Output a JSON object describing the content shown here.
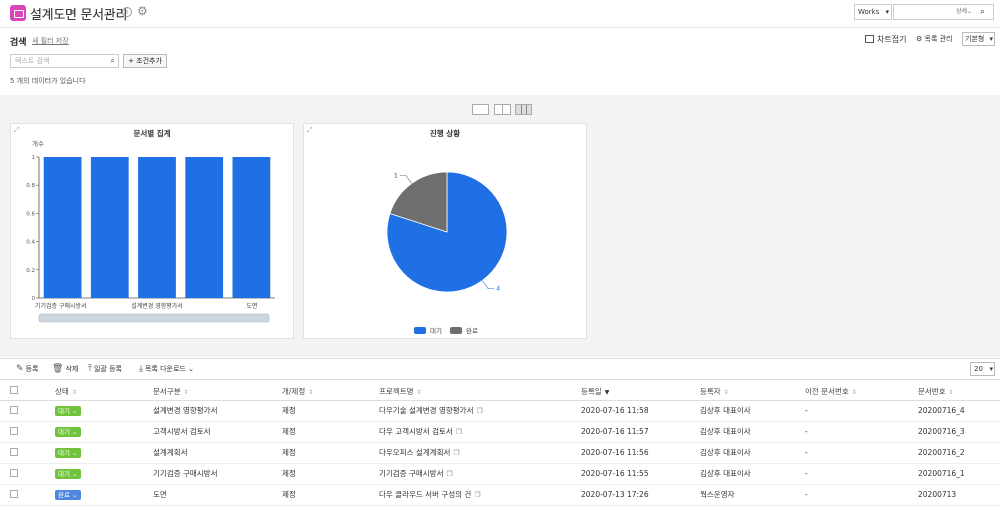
{
  "header": {
    "title": "설계도면 문서관리",
    "works_select": "Works",
    "search_option": "상세"
  },
  "search": {
    "label": "검색",
    "save_filter": "새 필터 저장",
    "placeholder": "텍스트 검색",
    "add_condition": "조건추가",
    "count_text": "5 개의 데이터가 있습니다",
    "chart_toggle": "차트접기",
    "list_mgmt": "목록 관리",
    "view_mode": "기본형"
  },
  "colors": {
    "blue": "#1f6fe5",
    "gray": "#6e6e6e",
    "badge_wait": "#71c33c",
    "badge_done": "#4f86e0",
    "accent_icon": "#d946b8"
  },
  "chart_data": [
    {
      "type": "bar",
      "title": "문서별 집계",
      "ylabel": "개수",
      "categories": [
        "기기검증 구매시방서",
        "고객시방서 검토서",
        "설계변경 영향평가서",
        "설계계획서",
        "도면"
      ],
      "tick_labels": [
        "기기검증 구매시방서",
        "설계변경 영향평가서",
        "도면"
      ],
      "values": [
        1,
        1,
        1,
        1,
        1
      ],
      "ylim": [
        0,
        1
      ],
      "yticks": [
        "0",
        "0.2",
        "0.4",
        "0.6",
        "0.8",
        "1"
      ]
    },
    {
      "type": "pie",
      "title": "진행 상황",
      "labels": [
        "대기",
        "완료"
      ],
      "values": [
        4,
        1
      ],
      "legend": "bottom"
    }
  ],
  "toolbar": {
    "register": "등록",
    "delete": "삭제",
    "bulk_register": "일괄 등록",
    "download_list": "목록 다운로드",
    "page_size": "20"
  },
  "table": {
    "headers": [
      "상태",
      "문서구분",
      "개/제정",
      "프로젝트명",
      "등록일",
      "등록자",
      "이전 문서번호",
      "문서번호"
    ],
    "rows": [
      {
        "status": "대기",
        "type": "설계변경 영향평가서",
        "rev": "제정",
        "project": "다우기술 설계변경 영향평가서",
        "date": "2020-07-16 11:58",
        "user": "김상후 대표이사",
        "prev": "-",
        "no": "20200716_4"
      },
      {
        "status": "대기",
        "type": "고객시방서 검토서",
        "rev": "제정",
        "project": "다우 고객시방서 검토서",
        "date": "2020-07-16 11:57",
        "user": "김상후 대표이사",
        "prev": "-",
        "no": "20200716_3"
      },
      {
        "status": "대기",
        "type": "설계계획서",
        "rev": "제정",
        "project": "다우오피스 설계계획서",
        "date": "2020-07-16 11:56",
        "user": "김상후 대표이사",
        "prev": "-",
        "no": "20200716_2"
      },
      {
        "status": "대기",
        "type": "기기검증 구매시방서",
        "rev": "제정",
        "project": "기기검증 구매시방서",
        "date": "2020-07-16 11:55",
        "user": "김상후 대표이사",
        "prev": "-",
        "no": "20200716_1"
      },
      {
        "status": "완료",
        "type": "도면",
        "rev": "제정",
        "project": "다우 클라우드 서버 구성의 건",
        "date": "2020-07-13 17:26",
        "user": "웍스운영자",
        "prev": "-",
        "no": "20200713"
      }
    ]
  }
}
